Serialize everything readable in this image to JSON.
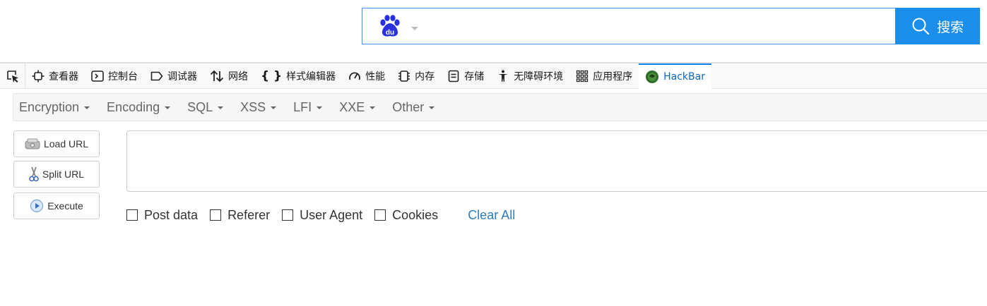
{
  "baidu": {
    "logo_text": "du",
    "search_button_label": "搜索",
    "search_value": "",
    "accent_color": "#1a8eea",
    "logo_color": "#2932e1"
  },
  "devtools": {
    "tabs": [
      {
        "label": "查看器",
        "icon": "inspector-icon"
      },
      {
        "label": "控制台",
        "icon": "console-icon"
      },
      {
        "label": "调试器",
        "icon": "debugger-icon"
      },
      {
        "label": "网络",
        "icon": "network-icon"
      },
      {
        "label": "样式编辑器",
        "icon": "style-editor-icon"
      },
      {
        "label": "性能",
        "icon": "performance-icon"
      },
      {
        "label": "内存",
        "icon": "memory-icon"
      },
      {
        "label": "存储",
        "icon": "storage-icon"
      },
      {
        "label": "无障碍环境",
        "icon": "accessibility-icon"
      },
      {
        "label": "应用程序",
        "icon": "application-icon"
      },
      {
        "label": "HackBar",
        "icon": "hackbar-icon",
        "active": true
      }
    ]
  },
  "hackbar": {
    "menus": [
      "Encryption",
      "Encoding",
      "SQL",
      "XSS",
      "LFI",
      "XXE",
      "Other"
    ],
    "load_url_label": "Load URL",
    "split_url_label": "Split URL",
    "execute_label": "Execute",
    "url_value": "",
    "options": [
      "Post data",
      "Referer",
      "User Agent",
      "Cookies"
    ],
    "clear_all_label": "Clear All"
  }
}
